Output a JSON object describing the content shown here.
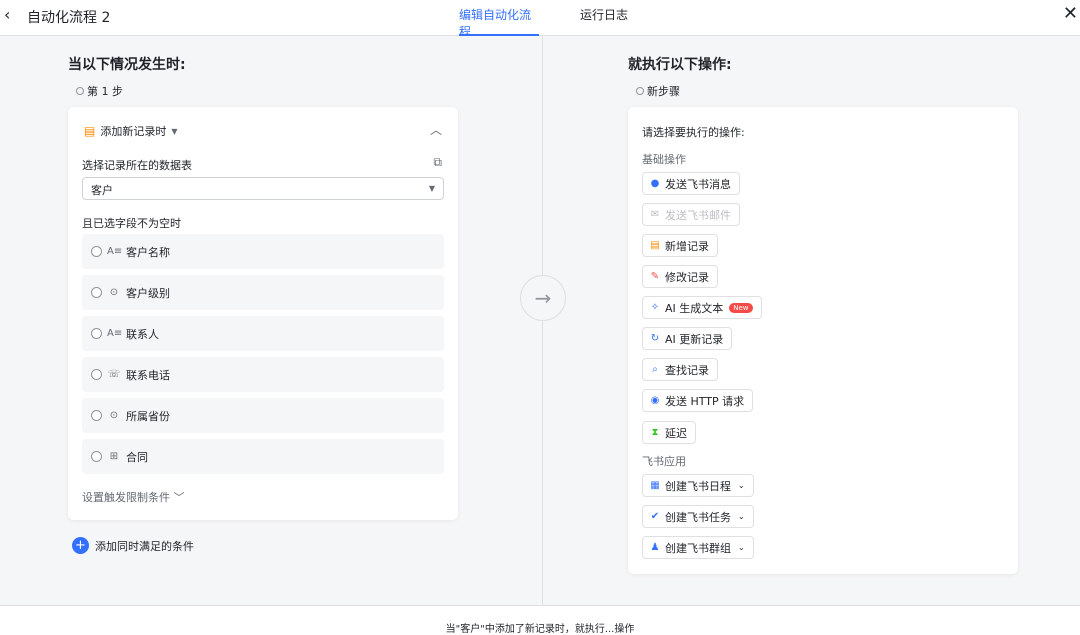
{
  "header": {
    "back_icon": "‹",
    "title": "自动化流程 2",
    "tabs": [
      {
        "label": "编辑自动化流程",
        "active": true
      },
      {
        "label": "运行日志",
        "active": false
      }
    ],
    "close_icon": "✕"
  },
  "trigger": {
    "section_title": "当以下情况发生时:",
    "step_label": "第 1 步",
    "trigger_label": "添加新记录时",
    "table_label": "选择记录所在的数据表",
    "table_value": "客户",
    "fields_label": "且已选字段不为空时",
    "fields": [
      {
        "type_icon": "A≡",
        "name": "客户名称"
      },
      {
        "type_icon": "⊙",
        "name": "客户级别"
      },
      {
        "type_icon": "A≡",
        "name": "联系人"
      },
      {
        "type_icon": "☏",
        "name": "联系电话"
      },
      {
        "type_icon": "⊙",
        "name": "所属省份"
      },
      {
        "type_icon": "⊞",
        "name": "合同"
      }
    ],
    "limit_label": "设置触发限制条件",
    "add_condition": "添加同时满足的条件"
  },
  "action": {
    "section_title": "就执行以下操作:",
    "step_label": "新步骤",
    "prompt": "请选择要执行的操作:",
    "basic_group": "基础操作",
    "basic_ops": [
      {
        "icon": "●",
        "label": "发送飞书消息",
        "color": "#3370ff",
        "disabled": false
      },
      {
        "icon": "✉",
        "label": "发送飞书邮件",
        "color": "#bbbfc4",
        "disabled": true
      },
      {
        "icon": "▤",
        "label": "新增记录",
        "color": "#ff8800",
        "disabled": false
      },
      {
        "icon": "✎",
        "label": "修改记录",
        "color": "#f54a45",
        "disabled": false
      },
      {
        "icon": "✧",
        "label": "AI 生成文本",
        "color": "#3370ff",
        "disabled": false,
        "badge": "New"
      },
      {
        "icon": "↻",
        "label": "AI 更新记录",
        "color": "#3370ff",
        "disabled": false
      },
      {
        "icon": "⌕",
        "label": "查找记录",
        "color": "#3370ff",
        "disabled": false
      },
      {
        "icon": "◉",
        "label": "发送 HTTP 请求",
        "color": "#3370ff",
        "disabled": false
      },
      {
        "icon": "⧗",
        "label": "延迟",
        "color": "#34c724",
        "disabled": false
      }
    ],
    "feishu_group": "飞书应用",
    "feishu_ops": [
      {
        "icon": "▦",
        "label": "创建飞书日程",
        "color": "#3370ff"
      },
      {
        "icon": "✔",
        "label": "创建飞书任务",
        "color": "#3370ff"
      },
      {
        "icon": "♟",
        "label": "创建飞书群组",
        "color": "#3370ff"
      }
    ]
  },
  "footer": {
    "summary": "当\"客户\"中添加了新记录时，就执行...操作"
  }
}
